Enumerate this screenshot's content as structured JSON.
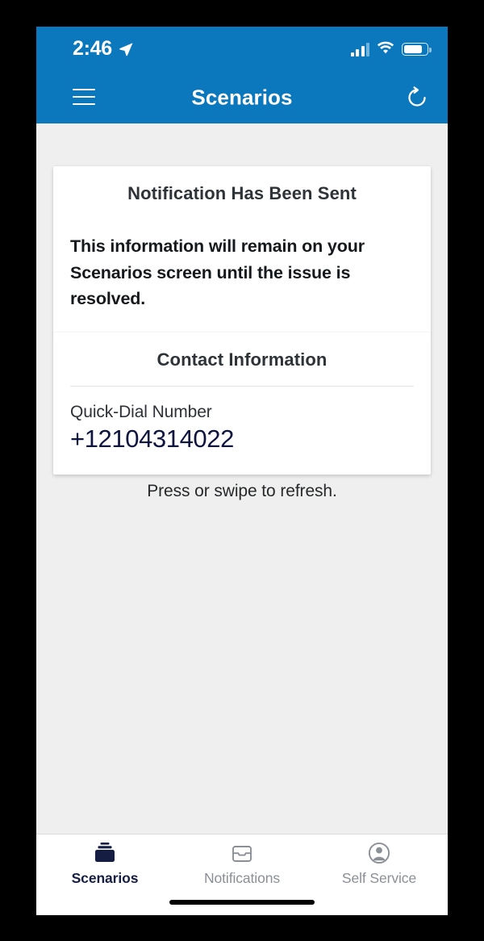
{
  "theme": {
    "header_blue": "#0b77bd",
    "page_background": "#efefef",
    "card_background": "#ffffff",
    "accent_navy": "#151e42",
    "phone_number_color": "#0e1440",
    "inactive_tab_gray": "#8b9096"
  },
  "status_bar": {
    "time": "2:46",
    "location_icon": "location-arrow-icon",
    "signal_icon": "cellular-signal-icon",
    "signal_bars_filled": 3,
    "signal_bars_total": 4,
    "wifi_icon": "wifi-icon",
    "battery_icon": "battery-icon",
    "battery_level_percent": 73
  },
  "header": {
    "menu_icon": "hamburger-menu-icon",
    "title": "Scenarios",
    "refresh_icon": "refresh-icon"
  },
  "notification_card": {
    "title": "Notification Has Been Sent",
    "body": "This information will remain on your Scenarios screen until the issue is resolved."
  },
  "contact_card": {
    "title": "Contact Information",
    "quick_dial_label": "Quick-Dial Number",
    "quick_dial_number": "+12104314022"
  },
  "refresh_hint": "Press or swipe to refresh.",
  "tab_bar": {
    "items": [
      {
        "label": "Scenarios",
        "icon": "stacked-boxes-icon",
        "active": true
      },
      {
        "label": "Notifications",
        "icon": "inbox-tray-icon",
        "active": false
      },
      {
        "label": "Self Service",
        "icon": "account-circle-icon",
        "active": false
      }
    ]
  }
}
